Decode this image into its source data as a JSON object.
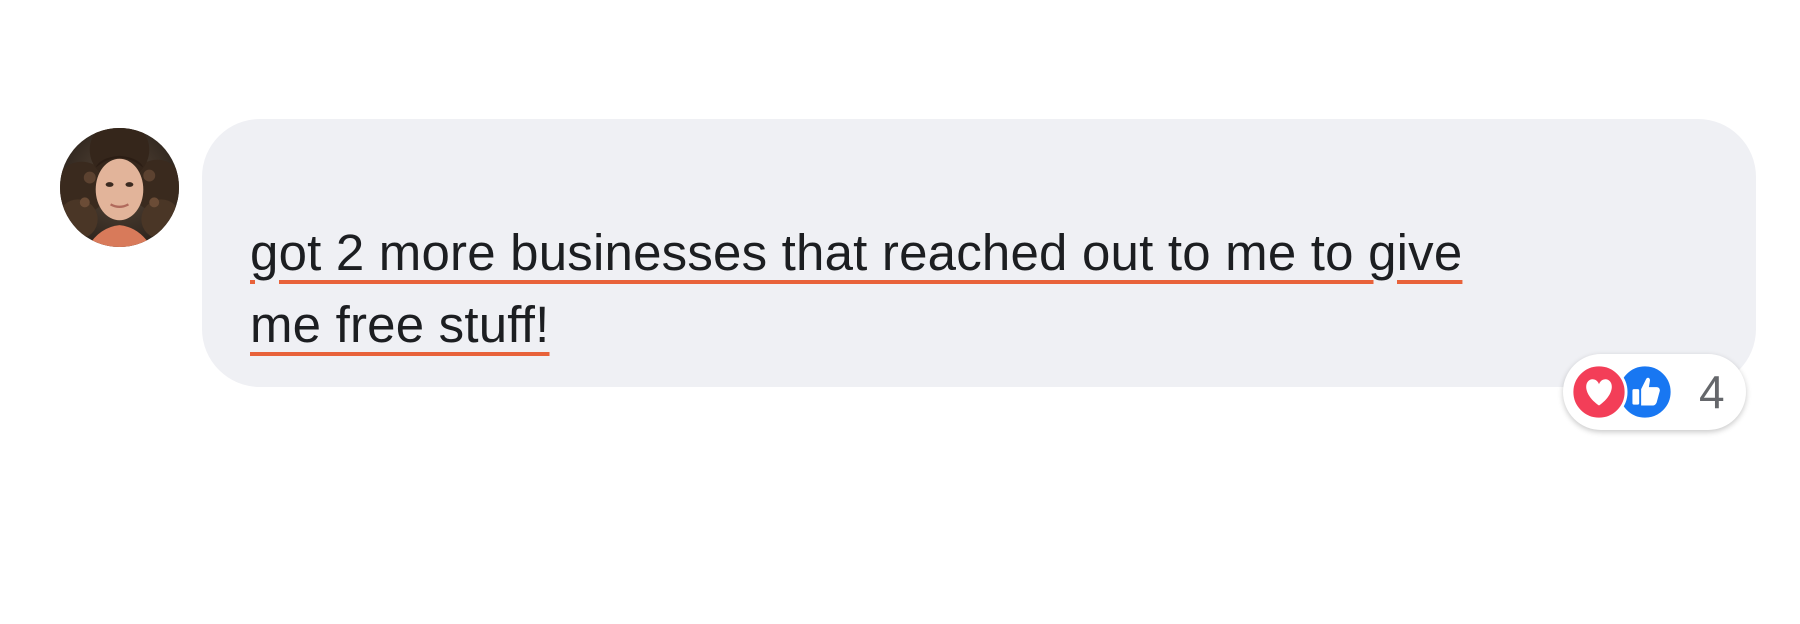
{
  "comment": {
    "line1": "got 2 more businesses that reached out to me to give",
    "line2": "me free stuff!",
    "underline_color": "#e8623a"
  },
  "reactions": {
    "types": [
      "love-icon",
      "like-icon"
    ],
    "count": "4",
    "love_color": "#f33e58",
    "like_color": "#1877f2"
  },
  "colors": {
    "bubble_bg": "#eff0f4",
    "text": "#1c1e21",
    "count_text": "#65676b"
  }
}
